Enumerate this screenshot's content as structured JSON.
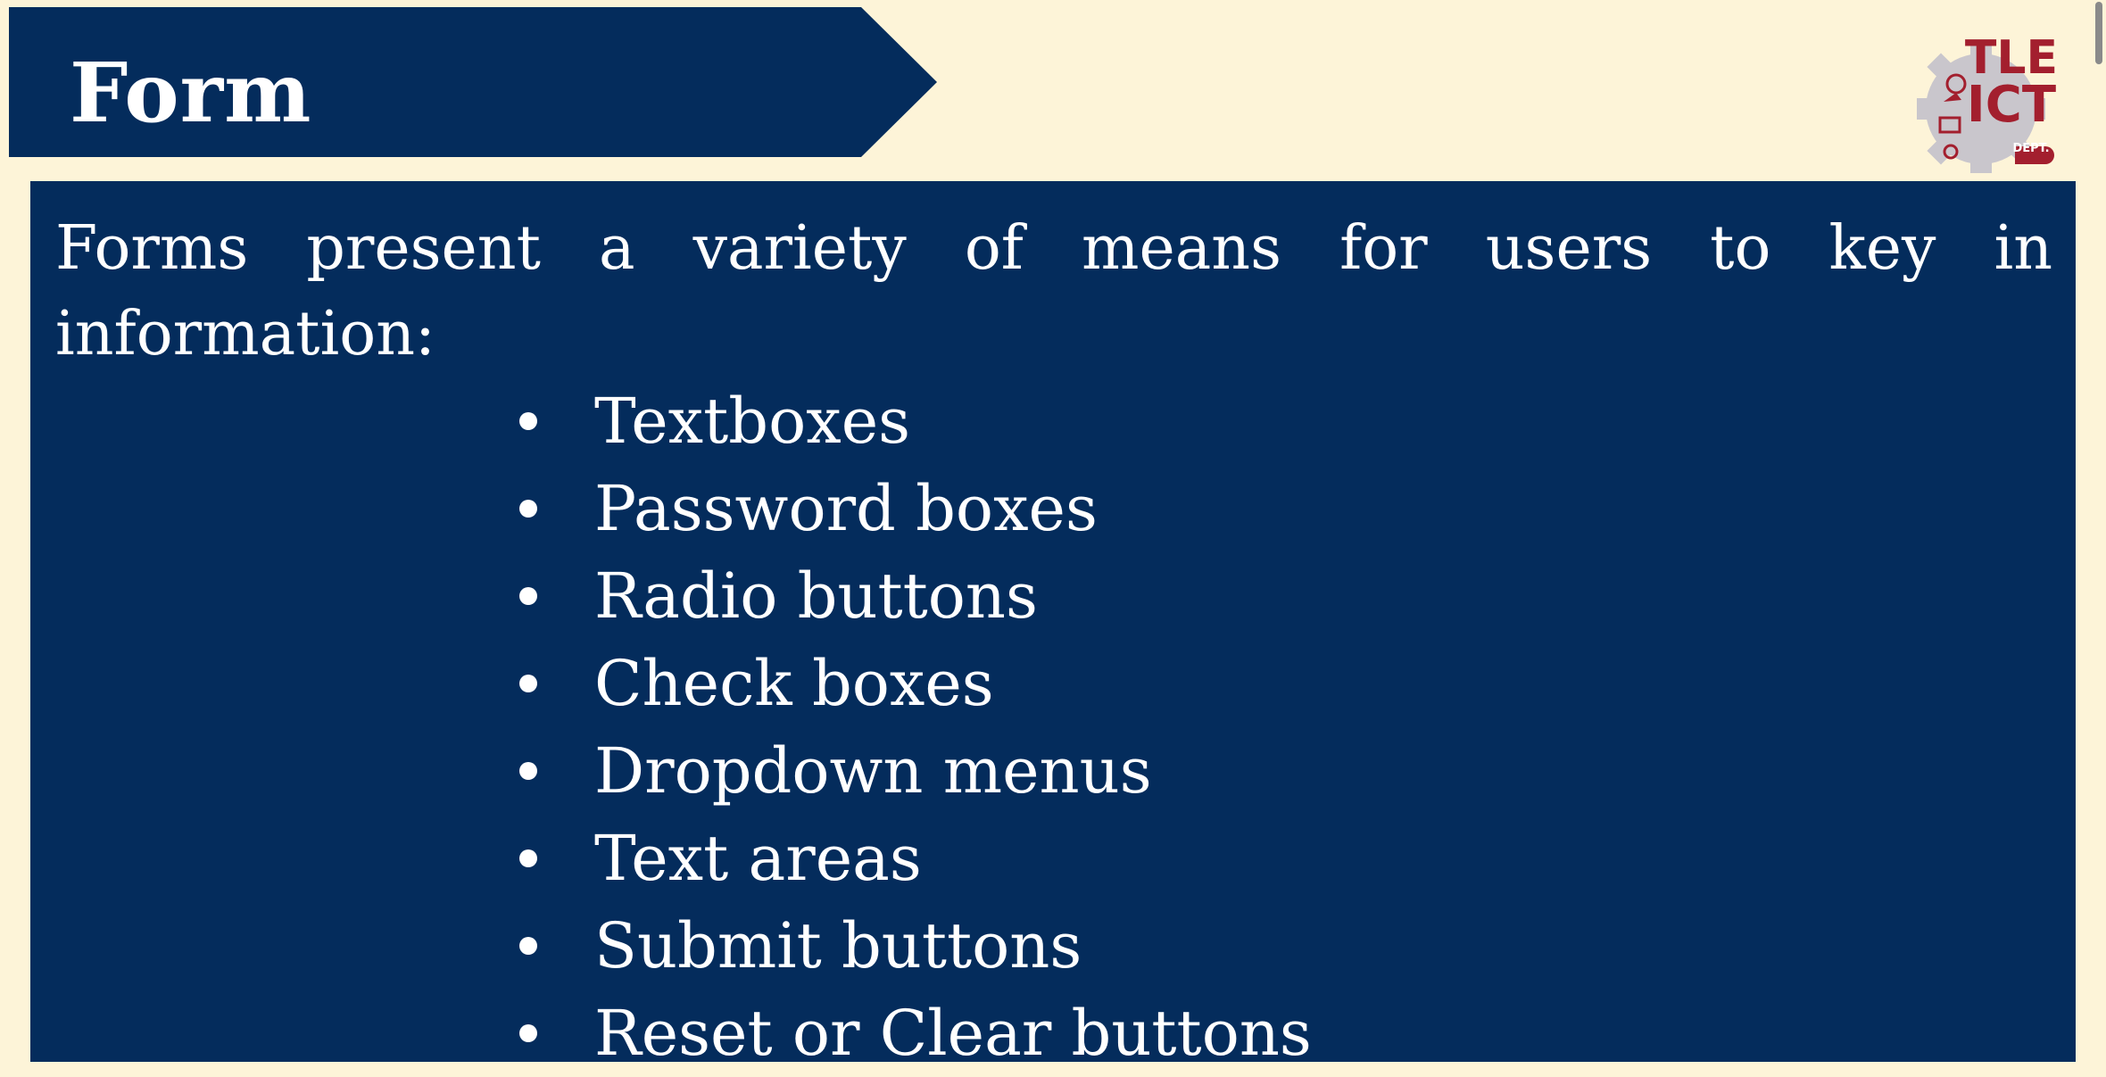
{
  "slide": {
    "title": "Form",
    "intro": "Forms present a variety of means for users to key in information:",
    "items": [
      "Textboxes",
      "Password boxes",
      "Radio buttons",
      "Check boxes",
      "Dropdown menus",
      "Text areas",
      "Submit buttons",
      "Reset or Clear buttons"
    ]
  },
  "logo": {
    "line1": "TLE",
    "line2": "ICT",
    "line3": "DEPT.",
    "icon": "gear-icon"
  },
  "colors": {
    "background": "#fdf4d8",
    "panel": "#042c5c",
    "logo_red": "#a31f2e",
    "logo_gray": "#c9c6cc"
  }
}
